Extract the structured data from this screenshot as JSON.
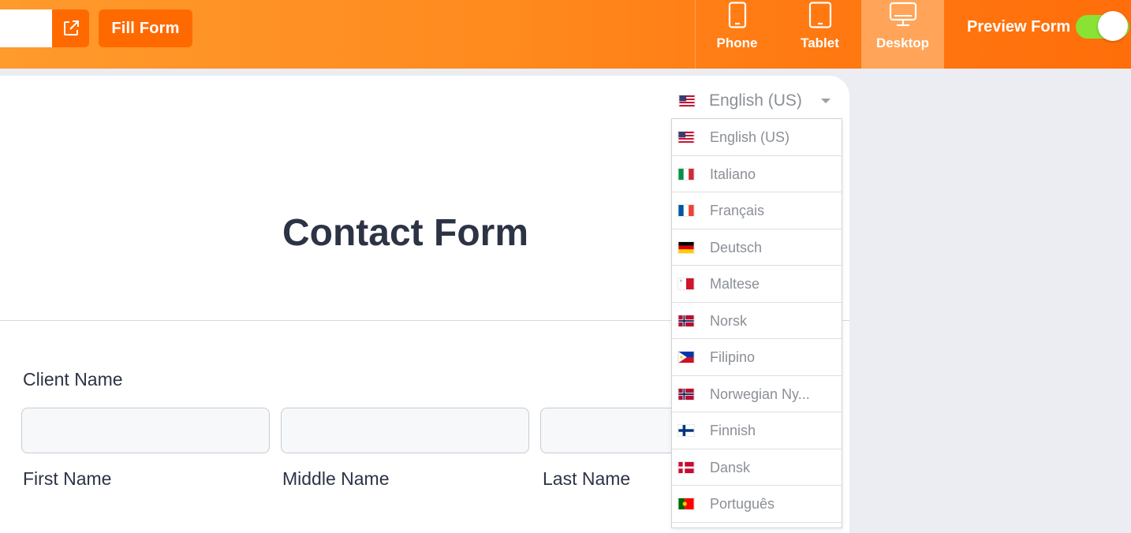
{
  "toolbar": {
    "fill_form_label": "Fill Form",
    "devices": [
      {
        "label": "Phone",
        "icon": "phone-icon",
        "active": false
      },
      {
        "label": "Tablet",
        "icon": "tablet-icon",
        "active": false
      },
      {
        "label": "Desktop",
        "icon": "desktop-icon",
        "active": true
      }
    ],
    "preview_label": "Preview Form",
    "preview_enabled": true
  },
  "language": {
    "selected": "English (US)",
    "options": [
      "English (US)",
      "Italiano",
      "Français",
      "Deutsch",
      "Maltese",
      "Norsk",
      "Filipino",
      "Norwegian Ny...",
      "Finnish",
      "Dansk",
      "Português"
    ]
  },
  "form": {
    "title": "Contact Form",
    "client_name_label": "Client Name",
    "first_name_label": "First Name",
    "middle_name_label": "Middle Name",
    "last_name_label": "Last Name"
  },
  "colors": {
    "accent": "#ff6a00",
    "toggle_on": "#8ae234",
    "title_text": "#2c3345"
  }
}
